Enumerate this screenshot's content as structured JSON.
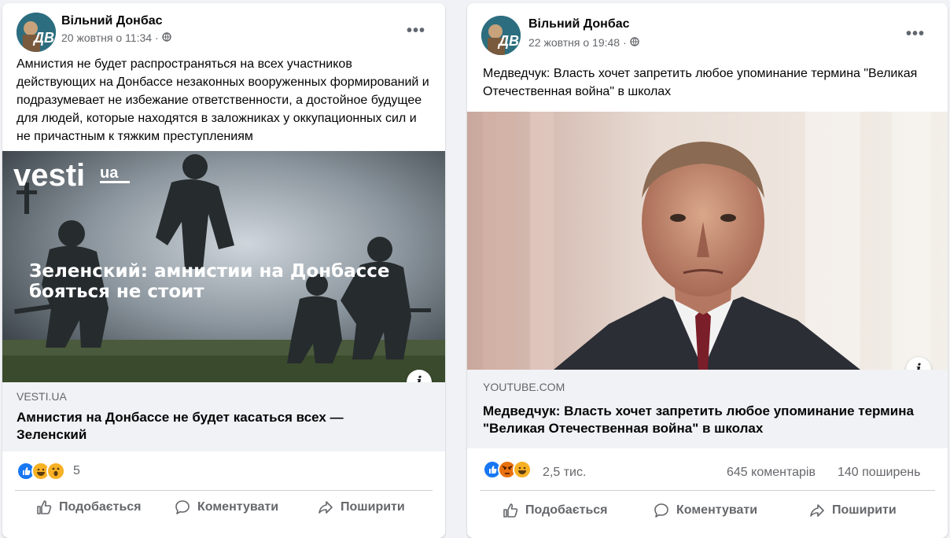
{
  "posts": [
    {
      "page_name": "Вільний Донбас",
      "timestamp": "20 жовтня о 11:34",
      "privacy_icon": "globe-icon",
      "more_icon": "more-dots-icon",
      "text": "Амнистия не будет распространяться на всех участников действующих на Донбассе незаконных вооруженных формирований и подразумевает не избежание ответственности, а достойное будущее для людей, которые находятся в заложниках у оккупационных сил и не причастным к тяжким преступлениям",
      "image": {
        "logo_text": "vesti",
        "logo_suffix": "ua",
        "overlay_line1": "Зеленский: амнистии на Донбассе",
        "overlay_line2": "бояться не стоит"
      },
      "link": {
        "domain": "VESTI.UA",
        "title": "Амнистия на Донбассе не будет касаться всех — Зеленский"
      },
      "reactions": {
        "count": "5",
        "comments": "",
        "shares": ""
      },
      "actions": {
        "like": "Подобається",
        "comment": "Коментувати",
        "share": "Поширити"
      }
    },
    {
      "page_name": "Вільний Донбас",
      "timestamp": "22 жовтня о 19:48",
      "privacy_icon": "globe-icon",
      "more_icon": "more-dots-icon",
      "text": "Медведчук: Власть хочет запретить любое упоминание термина \"Великая Отечественная война\" в школах",
      "link": {
        "domain": "YOUTUBE.COM",
        "title": "Медведчук: Власть хочет запретить любое упоминание термина \"Великая Отечественная война\" в школах"
      },
      "reactions": {
        "count": "2,5 тис.",
        "comments": "645 коментарів",
        "shares": "140 поширень"
      },
      "actions": {
        "like": "Подобається",
        "comment": "Коментувати",
        "share": "Поширити"
      }
    }
  ],
  "colors": {
    "like_blue": "#1877f2",
    "haha_yellow": "#f7b125",
    "angry_red": "#e9710f",
    "muted_text": "#65676b"
  }
}
